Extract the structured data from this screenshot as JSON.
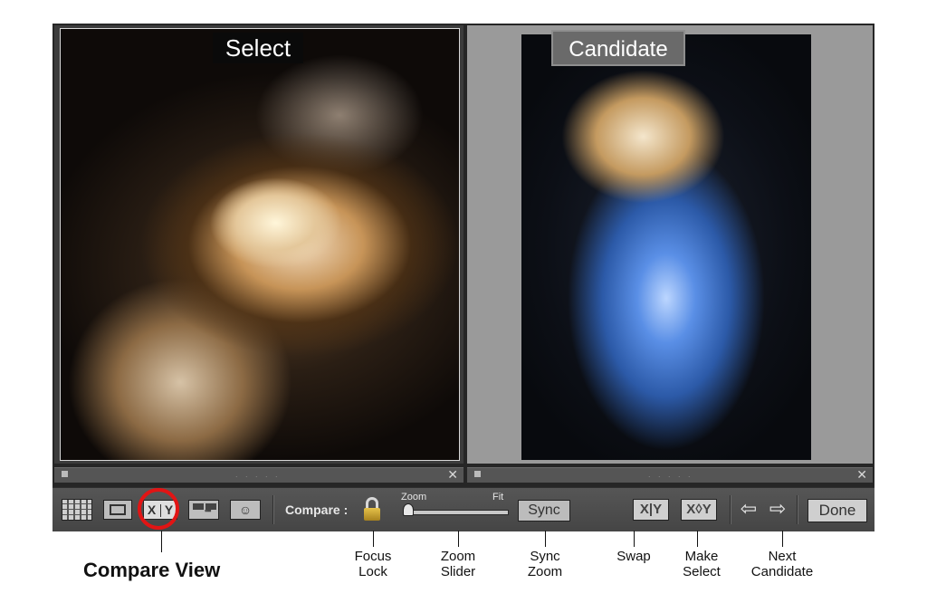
{
  "panes": {
    "select_label": "Select",
    "candidate_label": "Candidate"
  },
  "filmstrip": {
    "dots": ". . . . .",
    "close_symbol": "✕"
  },
  "toolbar": {
    "compare_label": "Compare :",
    "compare_view_x": "X",
    "compare_view_y": "Y",
    "zoom_label": "Zoom",
    "fit_label": "Fit",
    "zoom_level": 0,
    "sync_label": "Sync",
    "swap_label": "X|Y",
    "make_select_label": "X◊Y",
    "prev_arrow": "⇦",
    "next_arrow": "⇨",
    "done_label": "Done",
    "people_icon": "☺"
  },
  "callouts": {
    "compare_view": "Compare View",
    "focus_lock": [
      "Focus",
      "Lock"
    ],
    "zoom_slider": [
      "Zoom",
      "Slider"
    ],
    "sync_zoom": [
      "Sync",
      "Zoom"
    ],
    "swap": [
      "Swap"
    ],
    "make_select": [
      "Make",
      "Select"
    ],
    "next_candidate": [
      "Next",
      "Candidate"
    ]
  },
  "colors": {
    "highlight_ring": "#e21414",
    "toolbar_bg": "#4e4e4e",
    "lock_gold": "#d6b23a"
  }
}
